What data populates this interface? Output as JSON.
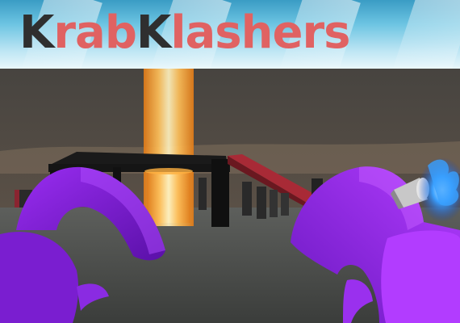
{
  "logo": {
    "parts": [
      "K",
      "rab",
      "K",
      "lashers"
    ]
  },
  "colors": {
    "logo_dark": "#2f2f2f",
    "logo_red": "#e06262",
    "claw_purple": "#8a2be2",
    "beam_orange": "#ffa640",
    "ramp_red": "#b0303a",
    "flame_blue": "#3aa0ff"
  },
  "icons": [
    "left-claw",
    "right-claw",
    "fire-beam",
    "blue-flame"
  ]
}
